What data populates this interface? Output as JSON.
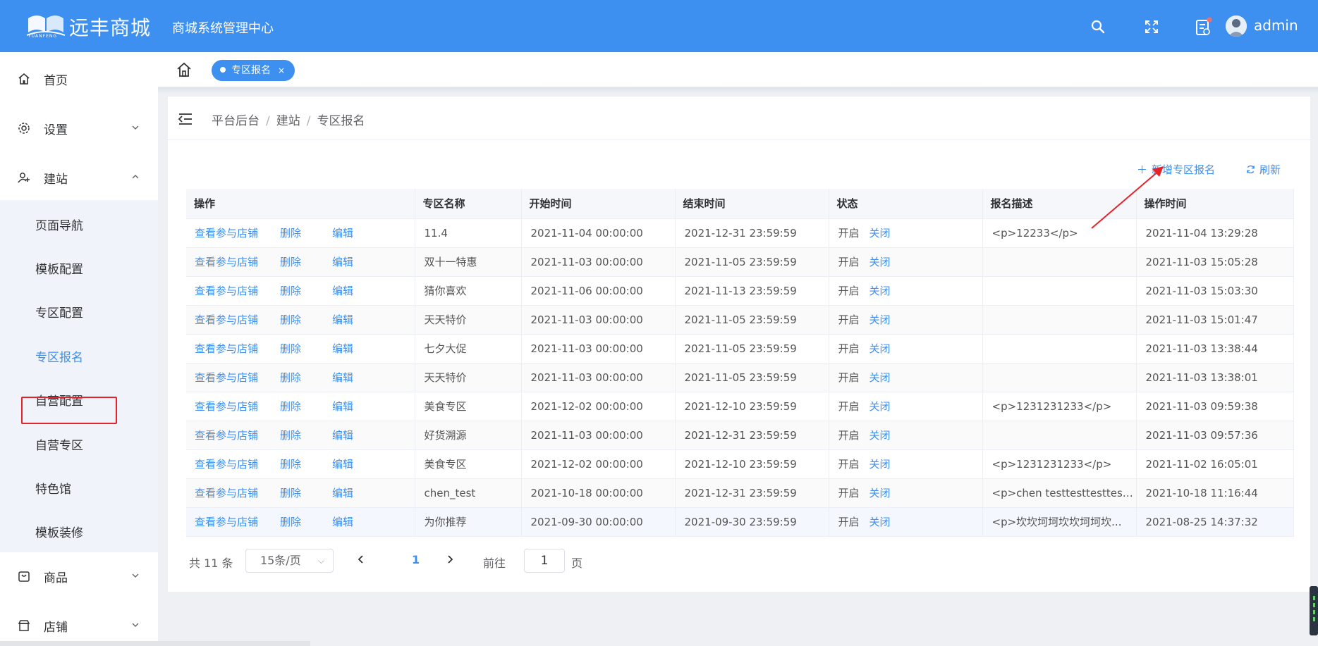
{
  "header": {
    "logo_text": "远丰商城",
    "logo_sub": "YUANFENG",
    "system_title": "商城系统管理中心",
    "username": "admin",
    "icons": [
      "search-icon",
      "fullscreen-icon",
      "notification-icon"
    ]
  },
  "sidebar": {
    "items": [
      {
        "label": "首页",
        "icon": "home-icon"
      },
      {
        "label": "设置",
        "icon": "gear-icon"
      },
      {
        "label": "建站",
        "icon": "site-icon"
      },
      {
        "label": "商品",
        "icon": "goods-icon"
      },
      {
        "label": "店铺",
        "icon": "shop-icon"
      }
    ],
    "submenu": [
      {
        "label": "页面导航"
      },
      {
        "label": "模板配置"
      },
      {
        "label": "专区配置"
      },
      {
        "label": "专区报名"
      },
      {
        "label": "自营配置"
      },
      {
        "label": "自营专区"
      },
      {
        "label": "特色馆"
      },
      {
        "label": "模板装修"
      }
    ]
  },
  "tabs": {
    "active_tab": "专区报名",
    "close_symbol": "×"
  },
  "breadcrumb": {
    "items": [
      "平台后台",
      "建站",
      "专区报名"
    ],
    "separator": "/"
  },
  "toolbar": {
    "add_label": "新增专区报名",
    "refresh_label": "刷新"
  },
  "table": {
    "columns": [
      "操作",
      "专区名称",
      "开始时间",
      "结束时间",
      "状态",
      "报名描述",
      "操作时间"
    ],
    "actions": {
      "view": "查看参与店铺",
      "delete": "删除",
      "edit": "编辑"
    },
    "status_text": "开启",
    "status_action": "关闭",
    "rows": [
      {
        "name": "11.4",
        "start": "2021-11-04 00:00:00",
        "end": "2021-12-31 23:59:59",
        "desc": "<p>12233</p>",
        "time": "2021-11-04 13:29:28"
      },
      {
        "name": "双十一特惠",
        "start": "2021-11-03 00:00:00",
        "end": "2021-11-05 23:59:59",
        "desc": "",
        "time": "2021-11-03 15:05:28"
      },
      {
        "name": "猜你喜欢",
        "start": "2021-11-06 00:00:00",
        "end": "2021-11-13 23:59:59",
        "desc": "",
        "time": "2021-11-03 15:03:30"
      },
      {
        "name": "天天特价",
        "start": "2021-11-03 00:00:00",
        "end": "2021-11-05 23:59:59",
        "desc": "",
        "time": "2021-11-03 15:01:47"
      },
      {
        "name": "七夕大促",
        "start": "2021-11-03 00:00:00",
        "end": "2021-11-05 23:59:59",
        "desc": "",
        "time": "2021-11-03 13:38:44"
      },
      {
        "name": "天天特价",
        "start": "2021-11-03 00:00:00",
        "end": "2021-11-05 23:59:59",
        "desc": "",
        "time": "2021-11-03 13:38:01"
      },
      {
        "name": "美食专区",
        "start": "2021-12-02 00:00:00",
        "end": "2021-12-10 23:59:59",
        "desc": "<p>1231231233</p>",
        "time": "2021-11-03 09:59:38"
      },
      {
        "name": "好货溯源",
        "start": "2021-11-03 00:00:00",
        "end": "2021-12-31 23:59:59",
        "desc": "",
        "time": "2021-11-03 09:57:36"
      },
      {
        "name": "美食专区",
        "start": "2021-12-02 00:00:00",
        "end": "2021-12-10 23:59:59",
        "desc": "<p>1231231233</p>",
        "time": "2021-11-02 16:05:01"
      },
      {
        "name": "chen_test",
        "start": "2021-10-18 00:00:00",
        "end": "2021-12-31 23:59:59",
        "desc": "<p>chen testtesttesttest...",
        "time": "2021-10-18 11:16:44"
      },
      {
        "name": "为你推荐",
        "start": "2021-09-30 00:00:00",
        "end": "2021-09-30 23:59:59",
        "desc": "<p>坎坎坷坷坎坎坷坷坎...",
        "time": "2021-08-25 14:37:32"
      }
    ]
  },
  "pagination": {
    "total_text": "共 11 条",
    "page_size": "15条/页",
    "current_page": "1",
    "goto_prefix": "前往",
    "goto_value": "1",
    "goto_suffix": "页"
  },
  "colors": {
    "primary": "#3d8ff0",
    "annotation": "#e6222b"
  }
}
